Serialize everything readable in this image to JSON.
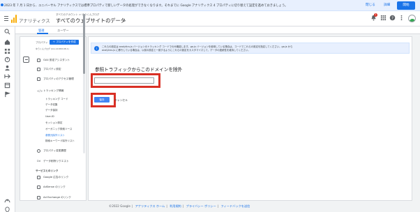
{
  "banner": {
    "message": "2023 年 7 月 1 日から、ユニバーサル アナリティクスでは標準プロパティで新しいデータの処理ができなくなります。それまでに Google アナリティクス 4 プロパティに切り替えて設定を進めておきましょう。",
    "close_label": "閉じる",
    "details_label": "詳細",
    "start_label": "開始"
  },
  "header": {
    "app_title": "アナリティクス",
    "breadcrumb": "すべてのアカウント > ゆうくんブログ",
    "property_title": "すべてのウェブサイトのデータ",
    "notification_count": "1",
    "icons": [
      "menu-icon",
      "analytics-logo",
      "chevron-down-icon",
      "notifications-icon",
      "apps-grid-icon",
      "help-icon",
      "more-vert-icon",
      "avatar"
    ]
  },
  "tabs": [
    {
      "label": "管理"
    },
    {
      "label": "ユーザー"
    }
  ],
  "admin": {
    "property_label": "プロパティ",
    "create_property_label": "＋ プロパティを作成",
    "property_sub": "ゆうくんブログ (UA-14180198-1)",
    "menu_items": [
      {
        "label": "GA4 設定アシスタント",
        "icon": "checklist-icon"
      },
      {
        "label": "プロパティ設定",
        "icon": "settings-icon"
      },
      {
        "label": "プロパティのアクセス管理",
        "icon": "people-icon"
      },
      {
        "label": "トラッキング情報",
        "icon": "code-icon"
      }
    ],
    "sub_items": [
      {
        "label": "トラッキング コード"
      },
      {
        "label": "データ収集"
      },
      {
        "label": "データ保持"
      },
      {
        "label": "User-ID"
      },
      {
        "label": "セッション設定"
      },
      {
        "label": "オーガニック検索ソース"
      },
      {
        "label": "参照元除外リスト"
      },
      {
        "label": "検索キーワード除外リスト"
      }
    ],
    "menu_items_2": [
      {
        "label": "プロパティ変更履歴",
        "icon": "history-icon"
      },
      {
        "label": "データ削除リクエスト",
        "icon": "dd-icon"
      }
    ],
    "section_label": "サービスとのリンク",
    "links": [
      {
        "label": "Google 広告のリンク",
        "icon": "google-ads-icon"
      },
      {
        "label": "AdSense のリンク",
        "icon": "adsense-icon"
      },
      {
        "label": "Ad Exchange のリンク",
        "icon": "ad-exchange-icon"
      }
    ]
  },
  "main": {
    "info_line1": "これらの設定は analytics.js バージョンのトラッキング コードでのみ機能します。ga.js バージョンを使用している場合は、コードでこれらの設定を指定してください。ga.js から",
    "info_line2": "analytics.js に移行している場合は、以前の設定と一致するようにこれらの設定をカスタマイズして、データの連続性を維持してください。",
    "section_title": "参照トラフィックからこのドメインを除外",
    "domain_value": "",
    "domain_placeholder": "",
    "save_label": "保存",
    "cancel_label": "キャンセル"
  },
  "footer": {
    "copyright": "©2022 Google",
    "analytics_home": "アナリティクス ホーム",
    "terms": "利用規約",
    "privacy": "プライバシー ポリシー",
    "feedback": "フィードバックを送信"
  },
  "colors": {
    "accent": "#1a73e8",
    "highlight": "#d93025",
    "logo": "#f9ab00"
  }
}
